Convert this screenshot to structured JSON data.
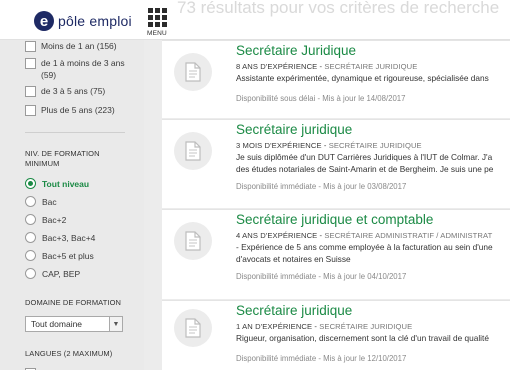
{
  "header": {
    "logo_letter": "e",
    "logo_text": "pôle emploi",
    "menu_label": "MENU",
    "results_heading": "73 résultats pour vos critères de recherche"
  },
  "sidebar": {
    "experience_options": [
      {
        "label": "Moins de 1 an (156)",
        "checked": false
      },
      {
        "label": "de 1 à moins de 3 ans (59)",
        "checked": false
      },
      {
        "label": "de 3 à 5 ans (75)",
        "checked": false
      },
      {
        "label": "Plus de 5 ans (223)",
        "checked": false
      }
    ],
    "niveau_title": "NIV. DE FORMATION MINIMUM",
    "niveau_options": [
      {
        "label": "Tout niveau",
        "selected": true
      },
      {
        "label": "Bac",
        "selected": false
      },
      {
        "label": "Bac+2",
        "selected": false
      },
      {
        "label": "Bac+3, Bac+4",
        "selected": false
      },
      {
        "label": "Bac+5 et plus",
        "selected": false
      },
      {
        "label": "CAP, BEP",
        "selected": false
      }
    ],
    "domaine_title": "DOMAINE DE FORMATION",
    "domaine_value": "Tout domaine",
    "langues_title": "LANGUES (2 MAXIMUM)"
  },
  "results": [
    {
      "title": "Secrétaire Juridique",
      "experience": "8 ANS D'EXPÉRIENCE",
      "sep": " - ",
      "category": "SECRÉTAIRE JURIDIQUE",
      "desc1": "Assistante expérimentée, dynamique et rigoureuse, spécialisée dans",
      "desc2": "",
      "availability": "Disponibilité sous délai",
      "updated": " - Mis à jour le 14/08/2017"
    },
    {
      "title": "Secrétaire juridique",
      "experience": "3 MOIS D'EXPÉRIENCE",
      "sep": " - ",
      "category": "SECRÉTAIRE JURIDIQUE",
      "desc1": "Je suis diplômée d'un DUT Carrières Juridiques à l'IUT de Colmar. J'a",
      "desc2": "des études notariales de Saint-Amarin et de Bergheim. Je suis une pe",
      "availability": "Disponibilité immédiate",
      "updated": " - Mis à jour le 03/08/2017"
    },
    {
      "title": "Secrétaire juridique et comptable",
      "experience": "4 ANS D'EXPÉRIENCE",
      "sep": " - ",
      "category": "SECRÉTAIRE ADMINISTRATIF / ADMINISTRAT",
      "desc1": "- Expérience de 5 ans comme employée à la facturation au sein d'une",
      "desc2": "d'avocats et notaires en Suisse",
      "availability": "Disponibilité immédiate",
      "updated": " - Mis à jour le 04/10/2017"
    },
    {
      "title": "Secrétaire juridique",
      "experience": "1 AN D'EXPÉRIENCE",
      "sep": " - ",
      "category": "SECRÉTAIRE JURIDIQUE",
      "desc1": "Rigueur, organisation, discernement sont la clé d'un travail de qualité",
      "desc2": "",
      "availability": "Disponibilité immédiate",
      "updated": " - Mis à jour le 12/10/2017"
    }
  ],
  "colors": {
    "accent_green": "#1b8a45",
    "brand_blue": "#1e2a64"
  }
}
